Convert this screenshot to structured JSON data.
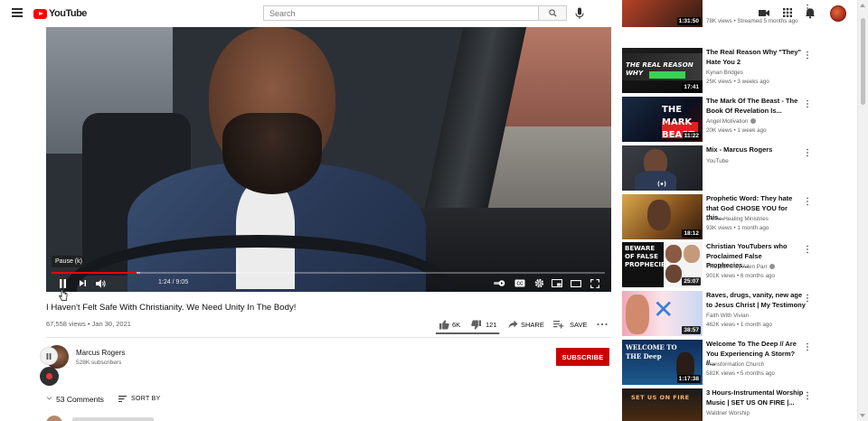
{
  "header": {
    "logo_text": "YouTube",
    "search_placeholder": "Search",
    "icons": [
      "menu-icon",
      "search-icon",
      "mic-icon",
      "create-video-icon",
      "apps-grid-icon",
      "bell-icon"
    ]
  },
  "player": {
    "tooltip": "Pause (k)",
    "time_display": "1:24 / 9:05",
    "progress_played": 0.154,
    "progress_buffered": 0.16,
    "colors": {
      "progress": "#ff0000"
    }
  },
  "video": {
    "title": "I Haven't Felt Safe With Christianity. We Need Unity In The Body!",
    "meta": "67,558 views • Jan 30, 2021",
    "likes": "6K",
    "dislikes": "121",
    "share_label": "SHARE",
    "save_label": "SAVE",
    "like_ratio": 0.98
  },
  "channel": {
    "name": "Marcus Rogers",
    "subscribers": "528K subscribers",
    "subscribe_label": "SUBSCRIBE",
    "subscribe_color": "#cc0000"
  },
  "comments": {
    "count_label": "53 Comments",
    "sort_label": "SORT BY"
  },
  "recommendations": [
    {
      "title": "",
      "channel": "",
      "meta": "78K views • Streamed 5 months ago",
      "duration": "1:31:50",
      "thumb_text": ""
    },
    {
      "title": "The Real Reason Why \"They\" Hate You 2",
      "channel": "Kynan Bridges",
      "meta": "25K views • 3 weeks ago",
      "duration": "17:41",
      "thumb_text": "THE REAL REASON WHY"
    },
    {
      "title": "The Mark Of The Beast - The Book Of Revelation Is...",
      "channel": "Angel Motivation",
      "meta": "20K views • 1 week ago",
      "duration": "11:22",
      "thumb_text": "THE MARK BEAST"
    },
    {
      "title": "Mix - Marcus Rogers",
      "channel": "YouTube",
      "meta": "",
      "duration": "",
      "thumb_text": ""
    },
    {
      "title": "Prophetic Word: They hate that God CHOSE YOU for this...",
      "channel": "Divine Healing Ministries",
      "meta": "93K views • 1 month ago",
      "duration": "18:12",
      "thumb_text": ""
    },
    {
      "title": "Christian YouTubers who Proclaimed False Prophecies...",
      "channel": "THE BEAT by Allen Parr",
      "meta": "901K views • 6 months ago",
      "duration": "25:07",
      "thumb_text": "BEWARE OF FALSE PROPHECIES!"
    },
    {
      "title": "Raves, drugs, vanity, new age to Jesus Christ | My Testimony",
      "channel": "Faith With Vivian",
      "meta": "462K views • 1 month ago",
      "duration": "38:57",
      "thumb_text": ""
    },
    {
      "title": "Welcome To The Deep // Are You Experiencing A Storm? //...",
      "channel": "Transformation Church",
      "meta": "582K views • 5 months ago",
      "duration": "1:17:38",
      "thumb_text": "WELCOME TO THE Deep"
    },
    {
      "title": "3 Hours-Instrumental Worship Music | SET US ON FIRE |...",
      "channel": "Waldner Worship",
      "meta": "",
      "duration": "",
      "thumb_text": "SET US ON FIRE"
    }
  ]
}
